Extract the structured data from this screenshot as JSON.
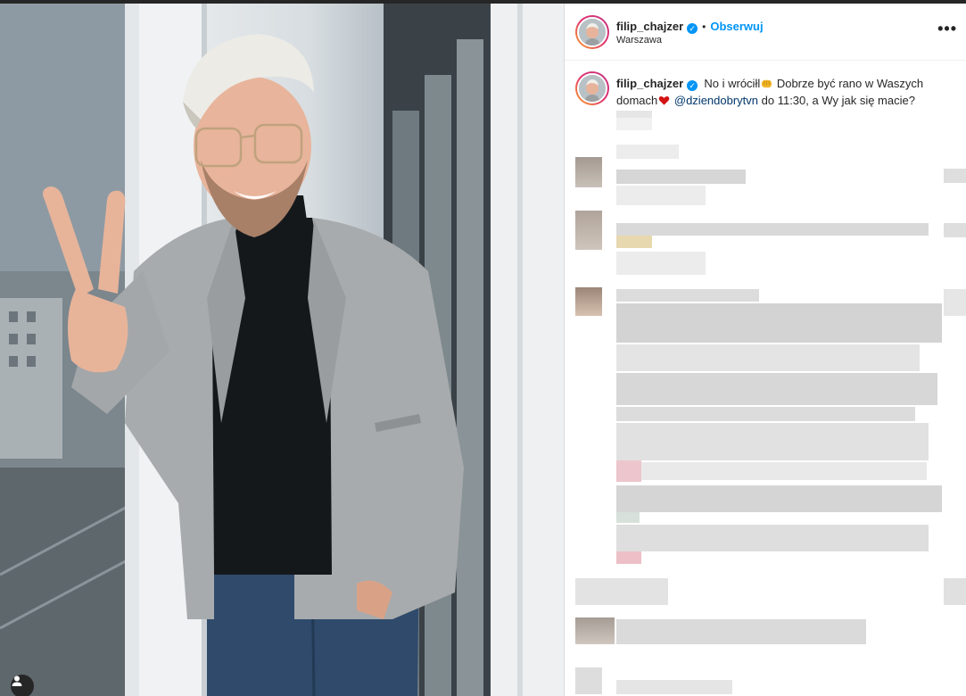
{
  "post": {
    "username": "filip_chajzer",
    "verified_icon": "verified-badge-icon",
    "separator": "•",
    "follow_label": "Obserwuj",
    "location": "Warszawa",
    "more_icon": "more-options-icon",
    "more_label": "•••"
  },
  "caption": {
    "username": "filip_chajzer",
    "text_1": "No i wróciłl",
    "text_2": " Dobrze być rano w Waszych domach",
    "mention": "@dziendobrytvn",
    "text_3": " do 11:30, a Wy jak się macie?",
    "emoji_1": "fist-emoji-icon",
    "emoji_2": "heart-emoji-icon"
  },
  "photo": {
    "tag_icon": "user-tag-icon"
  },
  "colors": {
    "accent": "#0095f6",
    "mention": "#00376b",
    "text": "#262626",
    "heart": "#d31313"
  }
}
